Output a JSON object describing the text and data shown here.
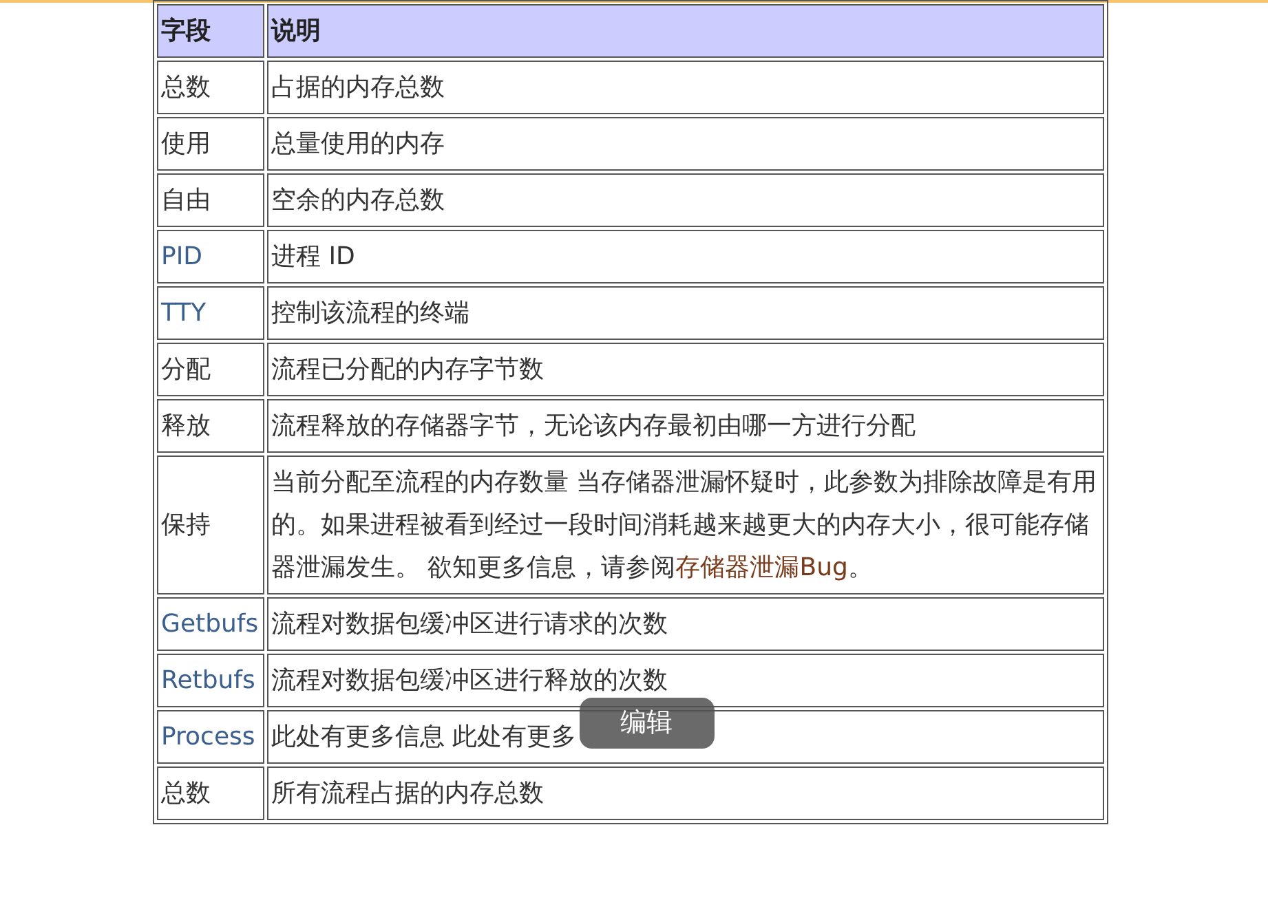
{
  "table": {
    "columns": [
      "字段",
      "说明"
    ],
    "rows": [
      {
        "field": "总数",
        "field_link": false,
        "description": "占据的内存总数"
      },
      {
        "field": "使用",
        "field_link": false,
        "description": "总量使用的内存"
      },
      {
        "field": "自由",
        "field_link": false,
        "description": "空余的内存总数"
      },
      {
        "field": "PID",
        "field_link": true,
        "description": "进程 ID"
      },
      {
        "field": "TTY",
        "field_link": true,
        "description": "控制该流程的终端"
      },
      {
        "field": "分配",
        "field_link": false,
        "description": "流程已分配的内存字节数"
      },
      {
        "field": "释放",
        "field_link": false,
        "description": "流程释放的存储器字节，无论该内存最初由哪一方进行分配"
      },
      {
        "field": "保持",
        "field_link": false,
        "description": "当前分配至流程的内存数量 当存储器泄漏怀疑时，此参数为排除故障是有用的。如果进程被看到经过一段时间消耗越来越更大的内存大小，很可能存储器泄漏发生。 欲知更多信息，请参阅",
        "link": "存储器泄漏Bug",
        "after": "。"
      },
      {
        "field": "Getbufs",
        "field_link": true,
        "description": "流程对数据包缓冲区进行请求的次数"
      },
      {
        "field": "Retbufs",
        "field_link": true,
        "description": "流程对数据包缓冲区进行释放的次数"
      },
      {
        "field": "Process",
        "field_link": true,
        "description": "此处有更多信息 此处有更多",
        "tooltip": "编辑"
      },
      {
        "field": "总数",
        "field_link": false,
        "description": "所有流程占据的内存总数"
      }
    ]
  }
}
